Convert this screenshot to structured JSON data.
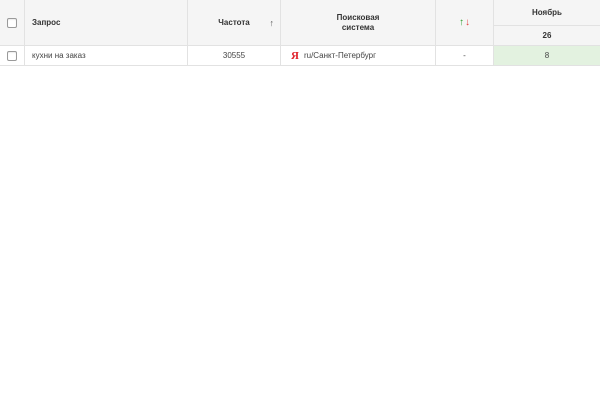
{
  "header": {
    "query_label": "Запрос",
    "frequency_label": "Частота",
    "frequency_sort_icon": "↑",
    "engine_label_line1": "Поисковая",
    "engine_label_line2": "система",
    "trend_up_icon": "↑",
    "trend_down_icon": "↓",
    "month_label": "Ноябрь",
    "day_label": "26"
  },
  "rows": [
    {
      "query": "кухни на заказ",
      "frequency": "30555",
      "engine_icon": "Я",
      "engine_region": "ru/Санкт-Петербург",
      "trend": "-",
      "position": "8"
    }
  ],
  "colors": {
    "header_bg": "#f5f5f5",
    "position_bg": "#e3f2e0",
    "yandex_red": "#e0202a",
    "up_green": "#2e9e2e",
    "down_red": "#e33b3b"
  }
}
